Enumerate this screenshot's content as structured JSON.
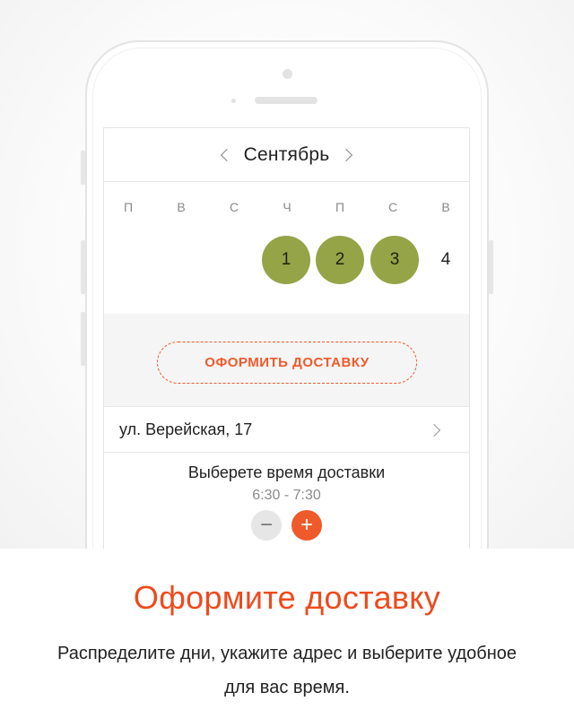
{
  "calendar": {
    "month": "Сентябрь",
    "weekdays": [
      "П",
      "В",
      "С",
      "Ч",
      "П",
      "С",
      "В"
    ],
    "days": [
      "1",
      "2",
      "3",
      "4"
    ],
    "selected_days": [
      "1",
      "2",
      "3"
    ]
  },
  "delivery": {
    "button_label": "ОФОРМИТЬ ДОСТАВКУ",
    "address": "ул. Верейская, 17",
    "time_title": "Выберете время доставки",
    "time_range": "6:30 - 7:30",
    "minus_label": "−",
    "plus_label": "+"
  },
  "promo": {
    "headline": "Оформите доставку",
    "description": "Распределите дни, укажите адрес и выберите удобное для вас время."
  },
  "colors": {
    "accent": "#ef5a2a",
    "selected_day": "#94a447"
  },
  "icons": [
    "chevron-left-icon",
    "chevron-right-icon",
    "minus-icon",
    "plus-icon"
  ]
}
